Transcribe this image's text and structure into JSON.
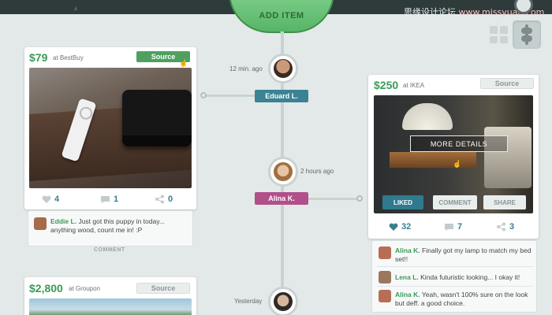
{
  "header": {
    "add_item_label": "ADD ITEM",
    "watermark_main": "思缘设计论坛",
    "watermark_brand": "www.missyuan.com"
  },
  "view_toggles": {
    "grid_icon": "grid-icon",
    "timeline_icon": "timeline-icon"
  },
  "timeline": [
    {
      "time": "12 min. ago",
      "name": "Eduard L."
    },
    {
      "time": "2 hours ago",
      "name": "Alina K."
    },
    {
      "time": "Yesterday",
      "name": ""
    }
  ],
  "cards": [
    {
      "price": "$79",
      "store": "at BestBuy",
      "source_label": "Source",
      "likes": "4",
      "comments": "1",
      "shares": "0",
      "comment_link": "COMMENT",
      "comment_list": [
        {
          "name": "Eddie L.",
          "text": "Just got this puppy in today... anything wood, count me in! :P"
        }
      ]
    },
    {
      "price": "$250",
      "store": "at IKEA",
      "source_label": "Source",
      "overlay_label": "MORE DETAILS",
      "actions": {
        "liked": "LIKED",
        "comment": "COMMENT",
        "share": "SHARE"
      },
      "likes": "32",
      "comments": "7",
      "shares": "3",
      "comment_list": [
        {
          "name": "Alina K.",
          "text": "Finally got my lamp to match my bed set!!"
        },
        {
          "name": "Lena L.",
          "text": "Kinda futuristic looking... I okay it!"
        },
        {
          "name": "Alina K.",
          "text": "Yeah, wasn't 100% sure on the look but deff. a good choice."
        }
      ]
    },
    {
      "price": "$2,800",
      "store": "at Groupon",
      "source_label": "Source"
    }
  ],
  "colors": {
    "accent_green": "#3a9a58",
    "teal": "#3a8294",
    "magenta": "#b14f8a",
    "background": "#e3e9e8"
  }
}
